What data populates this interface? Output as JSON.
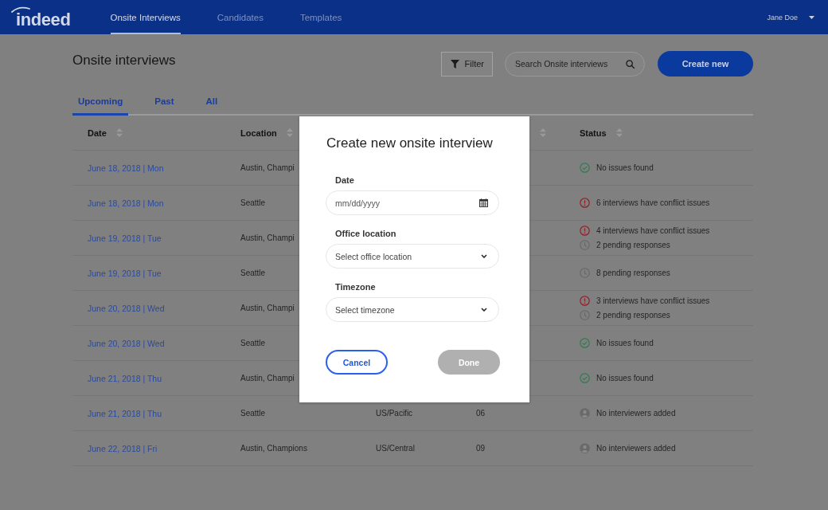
{
  "topbar": {
    "logo": "indeed",
    "nav": [
      {
        "label": "Onsite Interviews",
        "selected": true
      },
      {
        "label": "Candidates",
        "selected": false
      },
      {
        "label": "Templates",
        "selected": false
      }
    ],
    "user": "Jane Doe"
  },
  "page": {
    "title": "Onsite interviews",
    "filter_button": "Filter",
    "search": {
      "placeholder": "Search Onsite interviews"
    },
    "create_button": "Create new"
  },
  "tabs": [
    {
      "label": "Upcoming",
      "selected": true
    },
    {
      "label": "Past",
      "selected": false
    },
    {
      "label": "All",
      "selected": false
    }
  ],
  "table": {
    "columns": [
      {
        "label": "Date",
        "sortable": true
      },
      {
        "label": "Location",
        "sortable": true
      },
      {},
      {
        "sortable": true
      },
      {
        "label": "Status",
        "sortable": true
      }
    ],
    "rows": [
      {
        "date": "June 18, 2018 | Mon",
        "location": "Austin, Champi",
        "status": [
          {
            "kind": "ok",
            "text": "No issues found"
          }
        ]
      },
      {
        "date": "June 18, 2018 | Mon",
        "location": "Seattle",
        "status": [
          {
            "kind": "conflict",
            "text": "6 interviews have conflict issues"
          }
        ]
      },
      {
        "date": "June 19, 2018 | Tue",
        "location": "Austin, Champi",
        "status": [
          {
            "kind": "conflict",
            "text": "4 interviews have conflict issues"
          },
          {
            "kind": "pending",
            "text": "2 pending responses"
          }
        ]
      },
      {
        "date": "June 19, 2018 | Tue",
        "location": "Seattle",
        "status": [
          {
            "kind": "pending",
            "text": "8 pending responses"
          }
        ]
      },
      {
        "date": "June 20, 2018 | Wed",
        "location": "Austin, Champi",
        "status": [
          {
            "kind": "conflict",
            "text": "3 interviews have conflict issues"
          },
          {
            "kind": "pending",
            "text": "2 pending responses"
          }
        ]
      },
      {
        "date": "June 20, 2018 | Wed",
        "location": "Seattle",
        "status": [
          {
            "kind": "ok",
            "text": "No issues found"
          }
        ]
      },
      {
        "date": "June 21, 2018 | Thu",
        "location": "Austin, Champi",
        "status": [
          {
            "kind": "ok",
            "text": "No issues found"
          }
        ]
      },
      {
        "date": "June 21, 2018 | Thu",
        "location": "Seattle",
        "column_3": "US/Pacific",
        "column_4": "06",
        "status": [
          {
            "kind": "no_interviewers",
            "text": "No interviewers added"
          }
        ]
      },
      {
        "date": "June 22, 2018 | Fri",
        "location": "Austin, Champions",
        "column_3": "US/Central",
        "column_4": "09",
        "status": [
          {
            "kind": "no_interviewers",
            "text": "No interviewers added"
          }
        ]
      }
    ]
  },
  "modal": {
    "title": "Create new onsite interview",
    "fields": [
      {
        "kind": "date",
        "label": "Date",
        "placeholder": "mm/dd/yyyy"
      },
      {
        "kind": "select",
        "label": "Office location",
        "placeholder": "Select office location"
      },
      {
        "kind": "select",
        "label": "Timezone",
        "placeholder": "Select timezone"
      }
    ],
    "buttons": [
      {
        "kind": "secondary",
        "label": "Cancel",
        "disabled": false
      },
      {
        "kind": "primary",
        "label": "Done",
        "disabled": true
      }
    ]
  }
}
